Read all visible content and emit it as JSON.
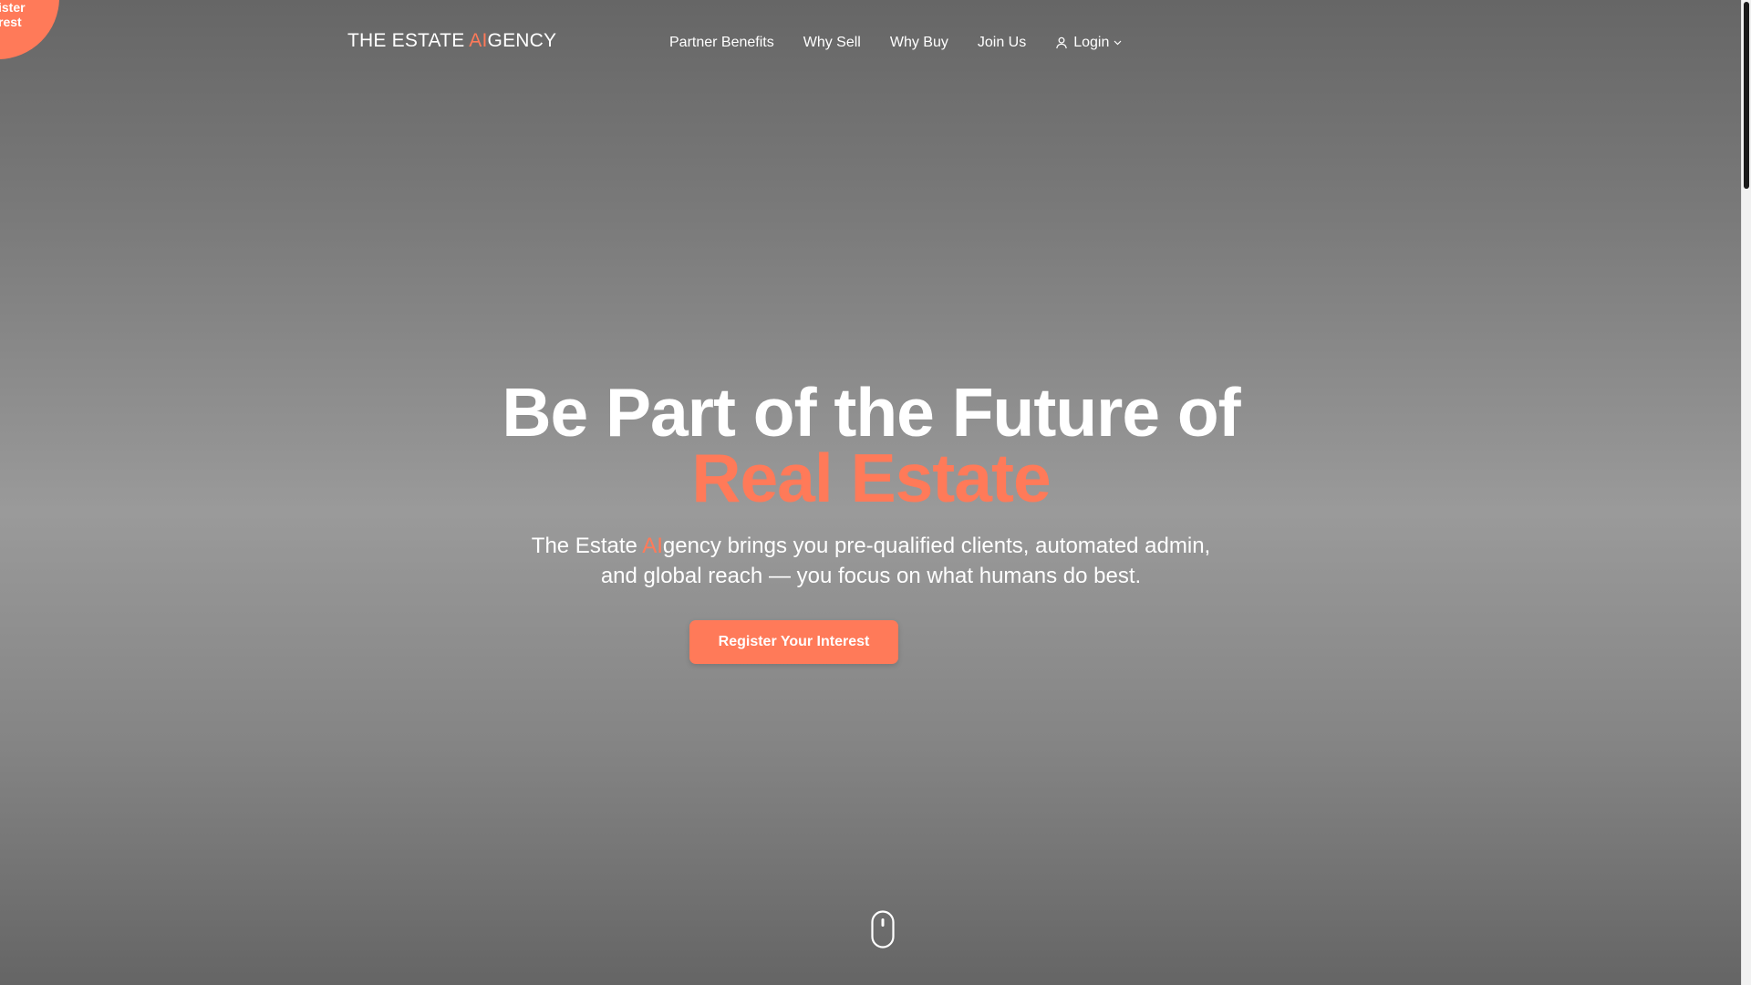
{
  "floating_badge": {
    "line1": "ister",
    "line2": "rest"
  },
  "header": {
    "logo_prefix": "THE ESTATE ",
    "logo_accent": "AI",
    "logo_suffix": "GENCY",
    "nav": [
      {
        "label": "Partner Benefits"
      },
      {
        "label": "Why Sell"
      },
      {
        "label": "Why Buy"
      },
      {
        "label": "Join Us"
      }
    ],
    "login_label": "Login"
  },
  "hero": {
    "title_line1": "Be Part of the Future of",
    "title_line2": "Real Estate",
    "subtitle_prefix": "The Estate ",
    "subtitle_accent": "AI",
    "subtitle_suffix": "gency brings you pre-qualified clients, automated admin, and global reach — you focus on what humans do best.",
    "cta_label": "Register Your Interest"
  },
  "icons": {
    "user": "user-icon",
    "chevron": "chevron-down-icon",
    "scroll": "mouse-scroll-icon"
  },
  "colors": {
    "accent": "#ff7a59",
    "text": "#ffffff",
    "background": "#8a8a8a"
  }
}
